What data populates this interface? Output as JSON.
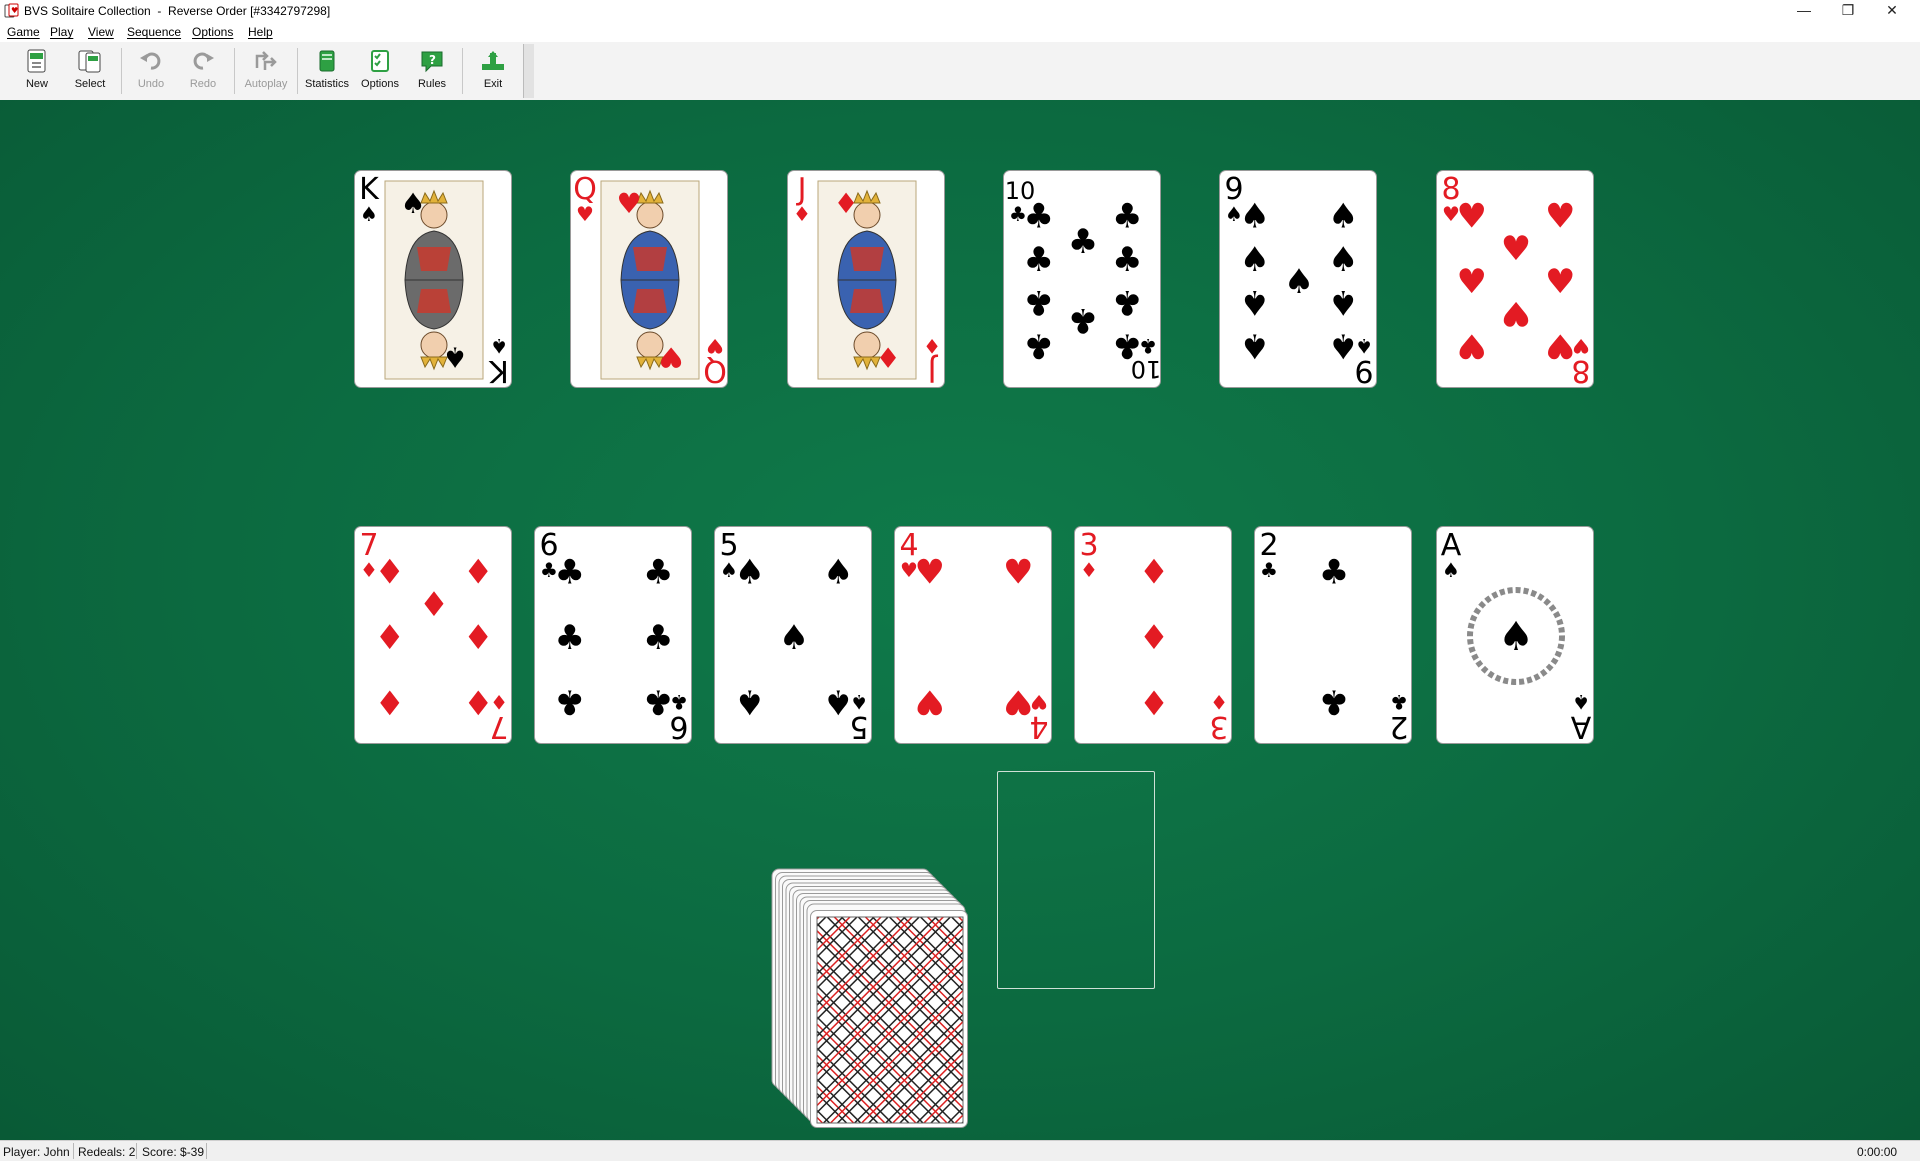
{
  "window": {
    "title": "BVS Solitaire Collection  -  Reverse Order [#3342797298]",
    "controls": {
      "minimize": "—",
      "restore": "❐",
      "close": "✕"
    }
  },
  "menu": [
    "Game",
    "Play",
    "View",
    "Sequence",
    "Options",
    "Help"
  ],
  "toolbar": {
    "new": "New",
    "select": "Select",
    "undo": "Undo",
    "redo": "Redo",
    "autoplay": "Autoplay",
    "statistics": "Statistics",
    "options": "Options",
    "rules": "Rules",
    "exit": "Exit"
  },
  "colors": {
    "felt": "#0c6a40",
    "red_suit": "#e31b23",
    "black_suit": "#000000",
    "toolbar_icon": "#2ea043"
  },
  "tableau": {
    "row1": [
      {
        "rank": "K",
        "suit": "♠",
        "color": "black",
        "face": true
      },
      {
        "rank": "Q",
        "suit": "♥",
        "color": "red",
        "face": true
      },
      {
        "rank": "J",
        "suit": "♦",
        "color": "red",
        "face": true
      },
      {
        "rank": "10",
        "suit": "♣",
        "color": "black",
        "face": false
      },
      {
        "rank": "9",
        "suit": "♠",
        "color": "black",
        "face": false
      },
      {
        "rank": "8",
        "suit": "♥",
        "color": "red",
        "face": false
      }
    ],
    "row2": [
      {
        "rank": "7",
        "suit": "♦",
        "color": "red",
        "face": false
      },
      {
        "rank": "6",
        "suit": "♣",
        "color": "black",
        "face": false
      },
      {
        "rank": "5",
        "suit": "♠",
        "color": "black",
        "face": false
      },
      {
        "rank": "4",
        "suit": "♥",
        "color": "red",
        "face": false
      },
      {
        "rank": "3",
        "suit": "♦",
        "color": "red",
        "face": false
      },
      {
        "rank": "2",
        "suit": "♣",
        "color": "black",
        "face": false
      },
      {
        "rank": "A",
        "suit": "♠",
        "color": "black",
        "face": false
      }
    ]
  },
  "stock": {
    "state": "face-down deck",
    "waste": "empty"
  },
  "status": {
    "player": "Player: John",
    "redeals": "Redeals: 2",
    "score": "Score: $-39",
    "time": "0:00:00"
  }
}
